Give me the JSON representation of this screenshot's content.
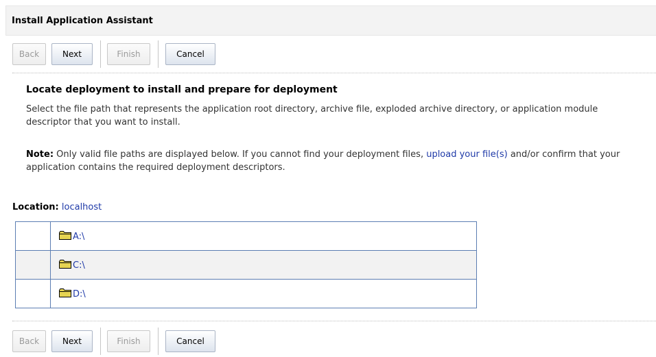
{
  "window": {
    "title": "Install Application Assistant"
  },
  "buttons": {
    "back": "Back",
    "next": "Next",
    "finish": "Finish",
    "cancel": "Cancel"
  },
  "content": {
    "heading": "Locate deployment to install and prepare for deployment",
    "description": "Select the file path that represents the application root directory, archive file, exploded archive directory, or application module descriptor that you want to install.",
    "note_label": "Note:",
    "note_text_before": " Only valid file paths are displayed below. If you cannot find your deployment files, ",
    "note_link": "upload your file(s)",
    "note_text_after": " and/or confirm that your application contains the required deployment descriptors."
  },
  "location": {
    "label": "Location:",
    "value": "localhost"
  },
  "files": [
    {
      "path": "A:\\"
    },
    {
      "path": "C:\\"
    },
    {
      "path": "D:\\"
    }
  ],
  "colors": {
    "link": "#1f3aa8",
    "table_border": "#5b7db2",
    "header_bg": "#f3f3f3"
  }
}
